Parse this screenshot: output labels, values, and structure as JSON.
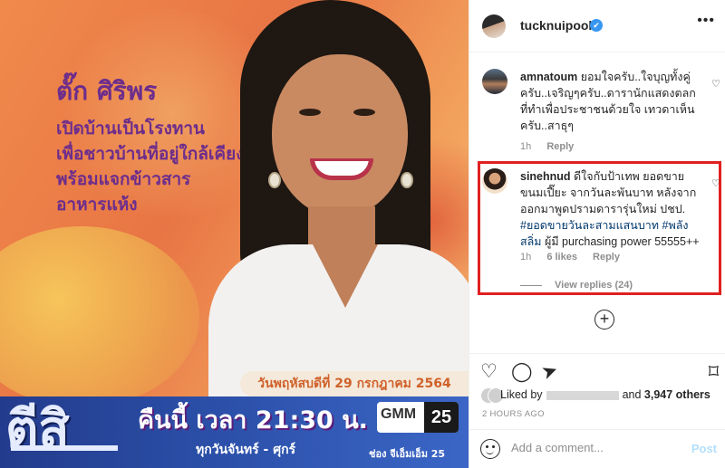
{
  "image": {
    "headline_name": "ตั๊ก ศิริพร",
    "headline_lines": [
      "เปิดบ้านเป็นโรงทาน",
      "เพื่อชาวบ้านที่อยู่ใกล้เคียง",
      "พร้อมแจกข้าวสาร",
      "อาหารแห้ง"
    ],
    "date_tag": "วันพฤหัสบดีที่ 29 กรกฎาคม 2564",
    "show_logo": "ตีสิ",
    "show_time": "คืนนี้ เวลา 21:30 น.",
    "show_days": "ทุกวันจันทร์ - ศุกร์",
    "channel_brand": "GMM",
    "channel_number": "25",
    "channel_label": "ช่อง จีเอ็มเอ็ม 25"
  },
  "header": {
    "username": "tucknuipooh",
    "verified_mark": "✔",
    "more_icon": "•••"
  },
  "comments": [
    {
      "username": "amnatoum",
      "text": "ยอมใจครับ..ใจบุญทั้งคู่ครับ..เจริญๆครับ..ดารานักแสดงตลก ที่ทำเพื่อประชาชนด้วยใจ เทวดาเห็นครับ..สาธุๆ",
      "age": "1h",
      "reply": "Reply"
    },
    {
      "username": "sinehnud",
      "text": "ดีใจกับป้าเทพ ยอดขายขนมเปี๊ยะ จากวันละพันบาท หลังจากออกมาพูดปรามดารารุ่นใหม่ ปชป.",
      "hashtags": "#ยอดขายวันละสามแสนบาท #พลังสลิ่ม",
      "extra": "ผู้มี purchasing power 55555++",
      "age": "1h",
      "likes": "6 likes",
      "reply": "Reply",
      "view_replies": "View replies (24)"
    }
  ],
  "load_more_icon": "+",
  "actions": {
    "like_icon": "♡",
    "comment_icon": "◯",
    "share_icon": "➤",
    "save_icon": "⌑"
  },
  "likes": {
    "prefix": "Liked by",
    "middle": "and",
    "count": "3,947 others"
  },
  "timestamp": "2 HOURS AGO",
  "add_comment": {
    "placeholder": "Add a comment...",
    "post_label": "Post"
  },
  "colors": {
    "highlight": "#e02020",
    "link": "#00376b",
    "verified": "#3897f0",
    "post_disabled": "#b2dffc"
  }
}
